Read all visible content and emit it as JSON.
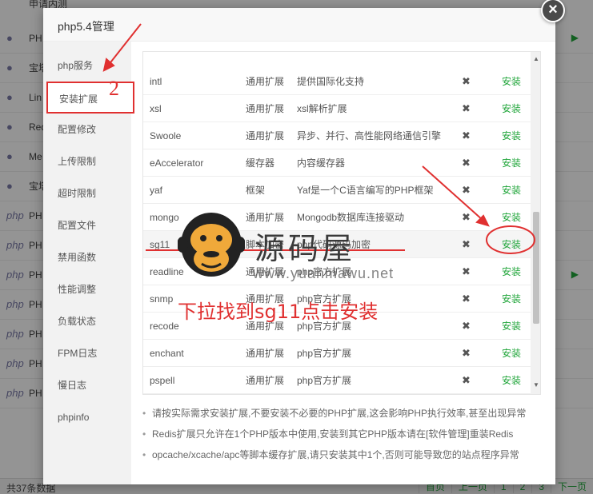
{
  "background": {
    "top_partial": "申请内测",
    "rows": [
      {
        "icon": "shield-icon",
        "name": "PH"
      },
      {
        "icon": "gauge-icon",
        "name": "宝塔"
      },
      {
        "icon": "tools-icon",
        "name": "Lin"
      },
      {
        "icon": "redis-icon",
        "name": "Red"
      },
      {
        "icon": "memcached-icon",
        "name": "Me"
      },
      {
        "icon": "anchor-icon",
        "name": "宝塔"
      },
      {
        "icon": "php-icon",
        "name": "PH"
      },
      {
        "icon": "php-icon",
        "name": "PH"
      },
      {
        "icon": "php-icon",
        "name": "PH"
      },
      {
        "icon": "php-icon",
        "name": "PH"
      },
      {
        "icon": "php-icon",
        "name": "PH"
      },
      {
        "icon": "php-icon",
        "name": "PH"
      },
      {
        "icon": "php-icon",
        "name": "PH"
      }
    ],
    "footer_total": "共37条数据",
    "pager": [
      "首页",
      "上一页",
      "1",
      "2",
      "3",
      "下一页"
    ]
  },
  "modal": {
    "title": "php5.4管理",
    "close_label": "×",
    "sidebar": [
      "php服务",
      "安装扩展",
      "配置修改",
      "上传限制",
      "超时限制",
      "配置文件",
      "禁用函数",
      "性能调整",
      "负载状态",
      "FPM日志",
      "慢日志",
      "phpinfo"
    ],
    "active_tab": "安装扩展",
    "extensions": [
      {
        "name": "intl",
        "type": "通用扩展",
        "desc": "提供国际化支持",
        "status": "✖",
        "op": "安装"
      },
      {
        "name": "xsl",
        "type": "通用扩展",
        "desc": "xsl解析扩展",
        "status": "✖",
        "op": "安装"
      },
      {
        "name": "Swoole",
        "type": "通用扩展",
        "desc": "异步、并行、高性能网络通信引擎",
        "status": "✖",
        "op": "安装"
      },
      {
        "name": "eAccelerator",
        "type": "缓存器",
        "desc": "内容缓存器",
        "status": "✖",
        "op": "安装"
      },
      {
        "name": "yaf",
        "type": "框架",
        "desc": "Yaf是一个C语言编写的PHP框架",
        "status": "✖",
        "op": "安装"
      },
      {
        "name": "mongo",
        "type": "通用扩展",
        "desc": "Mongodb数据库连接驱动",
        "status": "✖",
        "op": "安装"
      },
      {
        "name": "sg11",
        "type": "脚本加密",
        "desc": "php代码源码加密",
        "status": "✖",
        "op": "安装"
      },
      {
        "name": "readline",
        "type": "通用扩展",
        "desc": "php官方扩展",
        "status": "✖",
        "op": "安装"
      },
      {
        "name": "snmp",
        "type": "通用扩展",
        "desc": "php官方扩展",
        "status": "✖",
        "op": "安装"
      },
      {
        "name": "recode",
        "type": "通用扩展",
        "desc": "php官方扩展",
        "status": "✖",
        "op": "安装"
      },
      {
        "name": "enchant",
        "type": "通用扩展",
        "desc": "php官方扩展",
        "status": "✖",
        "op": "安装"
      },
      {
        "name": "pspell",
        "type": "通用扩展",
        "desc": "php官方扩展",
        "status": "✖",
        "op": "安装"
      }
    ],
    "notes": [
      "请按实际需求安装扩展,不要安装不必要的PHP扩展,这会影响PHP执行效率,甚至出现异常",
      "Redis扩展只允许在1个PHP版本中使用,安装到其它PHP版本请在[软件管理]重装Redis",
      "opcache/xcache/apc等脚本缓存扩展,请只安装其中1个,否则可能导致您的站点程序异常"
    ]
  },
  "annotations": {
    "step_number": "2",
    "instruction": "下拉找到sg11点击安装"
  },
  "watermark": {
    "title": "源码屋",
    "url": "www.yuanmawu.net"
  },
  "colors": {
    "accent_green": "#20a53a",
    "annotation_red": "#e03030"
  }
}
